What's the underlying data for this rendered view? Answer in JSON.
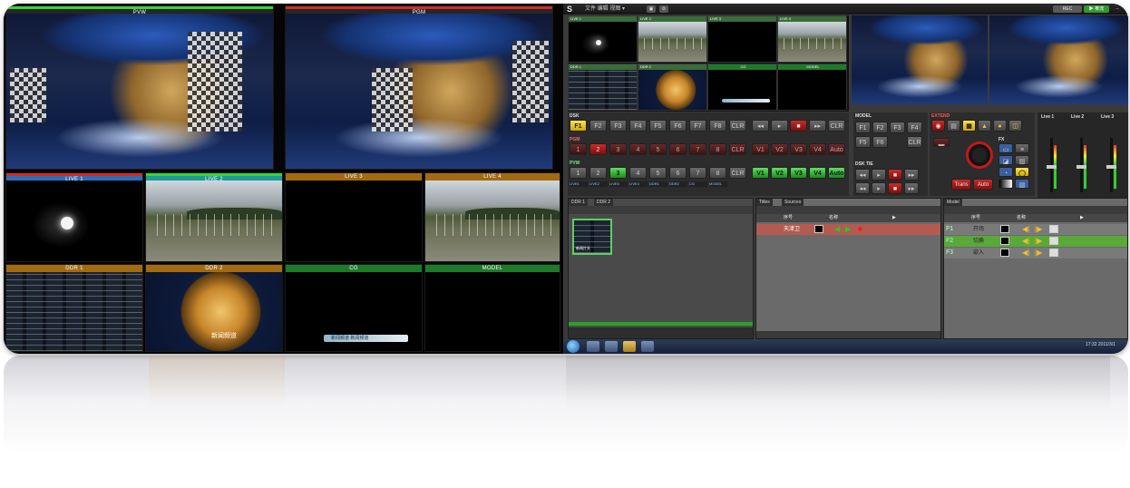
{
  "multiview": {
    "tiles": [
      {
        "label": "PVW",
        "stripe": "#39d339"
      },
      {
        "label": "PGM",
        "stripe": "#d22a2a"
      },
      {
        "label": "LIVE 1",
        "bar": "#2a6fb8",
        "stripe": "#d22a2a"
      },
      {
        "label": "LIVE 2",
        "bar": "#1e9a9a",
        "stripe": "#39d339"
      },
      {
        "label": "LIVE 3",
        "bar": "#a36a12"
      },
      {
        "label": "LIVE 4",
        "bar": "#a36a12"
      },
      {
        "label": "DDR 1",
        "bar": "#a36a12"
      },
      {
        "label": "DDR 2",
        "bar": "#a36a12"
      },
      {
        "label": "CG",
        "bar": "#1c7a2a"
      },
      {
        "label": "MODEL",
        "bar": "#1c7a2a"
      }
    ],
    "globe_caption": "新闻频道",
    "lower_third": "新闻频道 新闻频道"
  },
  "app": {
    "titlebar": {
      "logo": "S",
      "menu": "文件 编辑 视图 ▾",
      "record_label": "REC",
      "stream_label": "▶ 推流",
      "save_icon": "save-icon"
    },
    "previews": [
      {
        "label": "LIVE 1"
      },
      {
        "label": "LIVE 2"
      },
      {
        "label": "LIVE 3"
      },
      {
        "label": "LIVE 4"
      },
      {
        "label": "DDR 1"
      },
      {
        "label": "DDR 2"
      },
      {
        "label": "CG"
      },
      {
        "label": "MODEL"
      }
    ],
    "switcher": {
      "dsk_label": "DSK",
      "pgm_label": "PGM",
      "pvw_label": "PVW",
      "dsk_keys": [
        "F1",
        "F2",
        "F3",
        "F4",
        "F5",
        "F6",
        "F7",
        "F8",
        "CLR"
      ],
      "pgm_keys": [
        "1",
        "2",
        "3",
        "4",
        "5",
        "6",
        "7",
        "8",
        "CLR"
      ],
      "pvw_keys": [
        "1",
        "2",
        "3",
        "4",
        "5",
        "6",
        "7",
        "8",
        "CLR"
      ],
      "vkeys": [
        "V1",
        "V2",
        "V3",
        "V4",
        "Auto"
      ],
      "source_names": [
        "LIVE1",
        "LIVE2",
        "LIVE3",
        "LIVE4",
        "DDR1",
        "DDR2",
        "CG",
        "MODEL"
      ]
    },
    "model": {
      "label": "MODEL",
      "keys": [
        "F1",
        "F2",
        "F3",
        "F4",
        "F5",
        "F6",
        "CLR"
      ],
      "dsk_tie_label": "DSK TIE"
    },
    "extend": {
      "label": "EXTEND",
      "fx_label": "FX",
      "trans_label": "Trans",
      "auto_label": "Auto"
    },
    "audio": {
      "channels": [
        "Live 1",
        "Live 2",
        "Live 3"
      ]
    },
    "panels": {
      "ddr": {
        "tabs": [
          "DDR 1",
          "DDR 2"
        ],
        "clip": "新闻片头"
      },
      "cg": {
        "tabs": [
          "Titles",
          "Sources"
        ],
        "header": [
          "序号",
          "名称",
          "▶"
        ],
        "row_name": "天津卫"
      },
      "model": {
        "tabs": [
          "Model"
        ],
        "header": [
          "序号",
          "名称",
          "▶"
        ],
        "rows": [
          {
            "key": "F1",
            "name": "开场"
          },
          {
            "key": "F2",
            "name": "切换"
          },
          {
            "key": "F3",
            "name": "嵌入"
          }
        ]
      }
    },
    "taskbar": {
      "clock": "17:32 2011/3/1"
    }
  }
}
